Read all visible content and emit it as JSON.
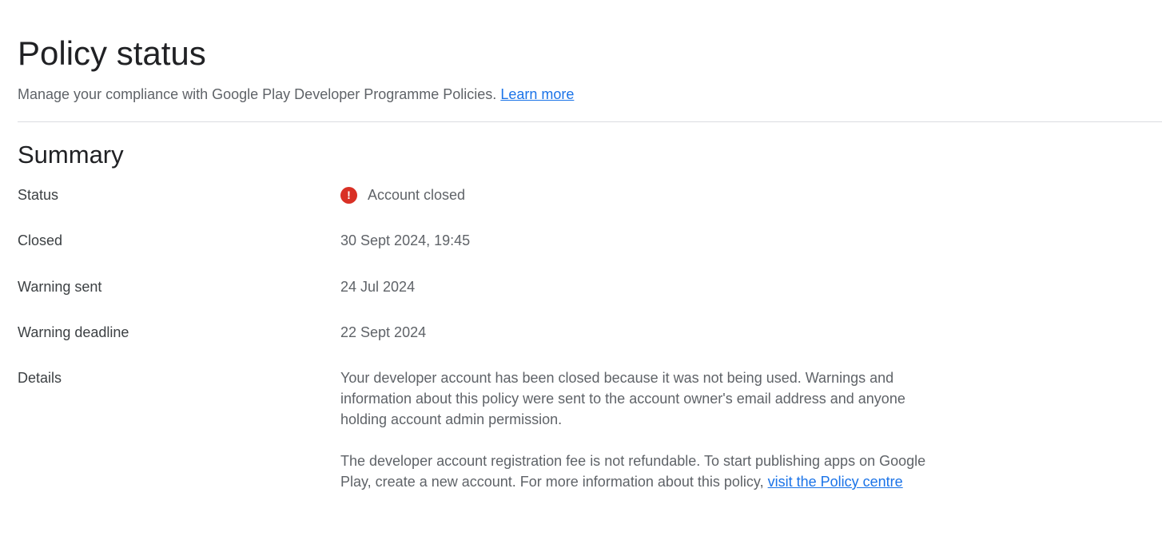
{
  "header": {
    "title": "Policy status",
    "subtitle": "Manage your compliance with Google Play Developer Programme Policies.",
    "learn_more": "Learn more"
  },
  "summary": {
    "title": "Summary",
    "status_label": "Status",
    "status_value": "Account closed",
    "status_icon": "error-icon",
    "closed_label": "Closed",
    "closed_value": "30 Sept 2024, 19:45",
    "warning_sent_label": "Warning sent",
    "warning_sent_value": "24 Jul 2024",
    "warning_deadline_label": "Warning deadline",
    "warning_deadline_value": "22 Sept 2024",
    "details_label": "Details",
    "details_paragraph1": "Your developer account has been closed because it was not being used. Warnings and information about this policy were sent to the account owner's email address and anyone holding account admin permission.",
    "details_paragraph2": "The developer account registration fee is not refundable. To start publishing apps on Google Play, create a new account. For more information about this policy,",
    "policy_link": "visit the Policy centre"
  },
  "colors": {
    "link": "#1a73e8",
    "error": "#d93025",
    "title": "#202124",
    "text": "#5f6368",
    "divider": "#dadce0"
  }
}
